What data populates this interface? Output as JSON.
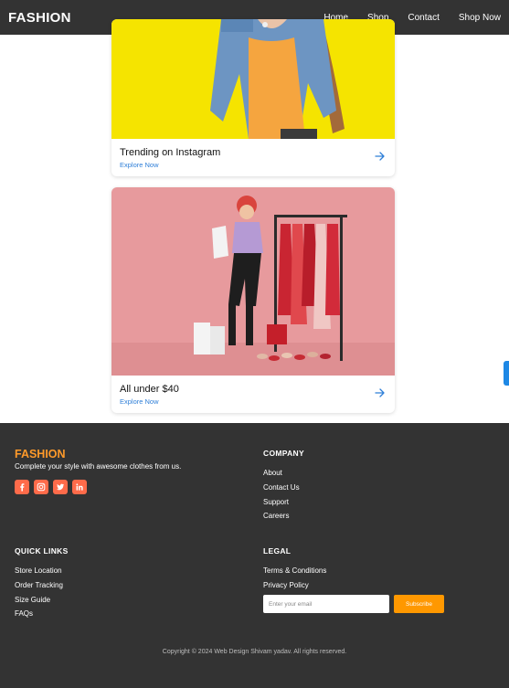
{
  "header": {
    "brand": "FASHION",
    "nav": [
      "Home",
      "Shop",
      "Contact",
      "Shop Now"
    ]
  },
  "cards": [
    {
      "title": "Trending on Instagram",
      "link": "Explore Now",
      "icon": "arrow-right-icon"
    },
    {
      "title": "All under $40",
      "link": "Explore Now",
      "icon": "arrow-right-icon"
    }
  ],
  "footer": {
    "brand": "FASHION",
    "tagline": "Complete your style with awesome clothes from us.",
    "socials": [
      "facebook-icon",
      "instagram-icon",
      "twitter-icon",
      "linkedin-icon"
    ],
    "company": {
      "heading": "COMPANY",
      "items": [
        "About",
        "Contact Us",
        "Support",
        "Careers"
      ]
    },
    "quick_links": {
      "heading": "QUICK LINKS",
      "items": [
        "Store Location",
        "Order Tracking",
        "Size Guide",
        "FAQs"
      ]
    },
    "legal": {
      "heading": "LEGAL",
      "items": [
        "Terms & Conditions",
        "Privacy Policy"
      ]
    },
    "newsletter": {
      "placeholder": "Enter your email",
      "button": "Subscribe"
    },
    "copyright": "Copyright © 2024 Web Design Shivam yadav. All rights reserved."
  },
  "colors": {
    "header_bg": "#333333",
    "accent_orange": "#ff9a2a",
    "social_bg": "#ff6b4a",
    "link_blue": "#2f7fd8",
    "subscribe_bg": "#ff9800"
  }
}
